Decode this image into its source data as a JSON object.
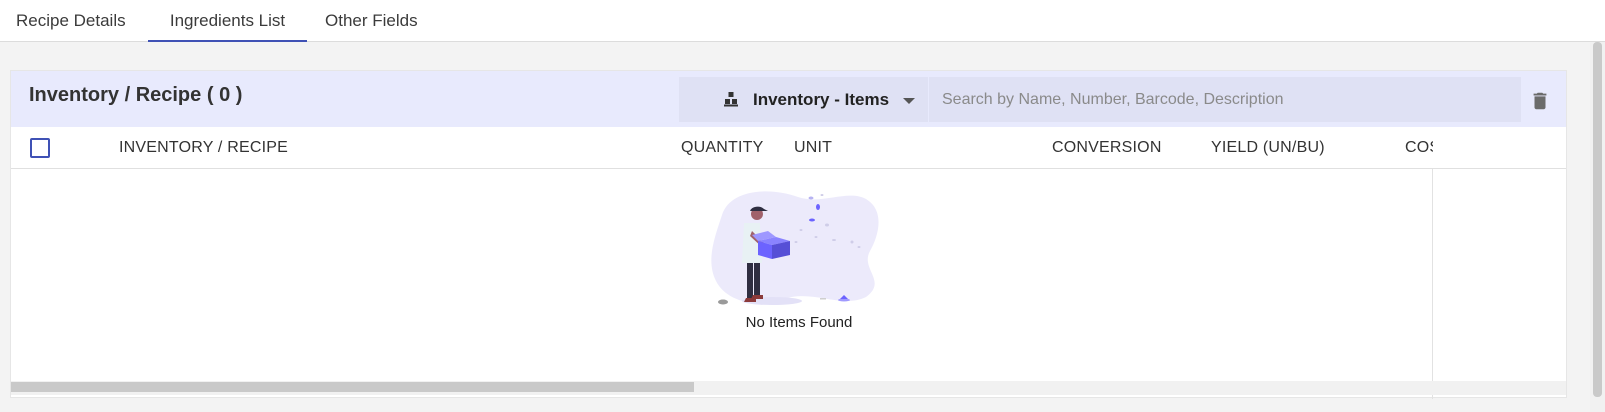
{
  "tabs": [
    {
      "label": "Recipe Details",
      "active": false
    },
    {
      "label": "Ingredients List",
      "active": true
    },
    {
      "label": "Other Fields",
      "active": false
    }
  ],
  "panel": {
    "title": "Inventory / Recipe",
    "count_open": "(",
    "count": "0",
    "count_close": ")",
    "dropdown": {
      "icon": "boxes-icon",
      "selected": "Inventory - Items"
    },
    "search": {
      "placeholder": "Search by Name, Number, Barcode, Description",
      "value": ""
    },
    "delete_icon": "trash-icon"
  },
  "table": {
    "columns": [
      "INVENTORY / RECIPE",
      "QUANTITY",
      "UNIT",
      "CONVERSION",
      "YIELD (UN/BU)",
      "COS"
    ],
    "rows": [],
    "empty_message": "No Items Found"
  },
  "colors": {
    "accent": "#3f51b5",
    "header_bg": "#e8eafd",
    "control_bg": "#dfe1f4",
    "illustration_purple": "#6c63ff"
  }
}
